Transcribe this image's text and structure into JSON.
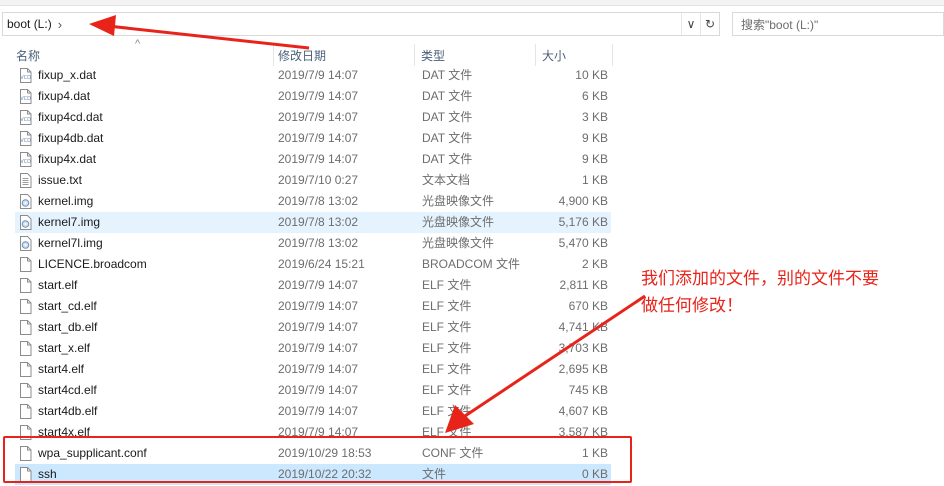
{
  "address": {
    "crumb": "boot (L:)",
    "chevron": "›",
    "dropdown_glyph": "∨",
    "refresh_glyph": "↻"
  },
  "search": {
    "placeholder": "搜索\"boot (L:)\""
  },
  "columns": {
    "name": "名称",
    "date": "修改日期",
    "type": "类型",
    "size": "大小"
  },
  "files": [
    {
      "icon": "dat-file-icon",
      "name": "fixup_x.dat",
      "date": "2019/7/9 14:07",
      "type": "DAT 文件",
      "size": "10 KB",
      "state": "normal"
    },
    {
      "icon": "dat-file-icon",
      "name": "fixup4.dat",
      "date": "2019/7/9 14:07",
      "type": "DAT 文件",
      "size": "6 KB",
      "state": "normal"
    },
    {
      "icon": "dat-file-icon",
      "name": "fixup4cd.dat",
      "date": "2019/7/9 14:07",
      "type": "DAT 文件",
      "size": "3 KB",
      "state": "normal"
    },
    {
      "icon": "dat-file-icon",
      "name": "fixup4db.dat",
      "date": "2019/7/9 14:07",
      "type": "DAT 文件",
      "size": "9 KB",
      "state": "normal"
    },
    {
      "icon": "dat-file-icon",
      "name": "fixup4x.dat",
      "date": "2019/7/9 14:07",
      "type": "DAT 文件",
      "size": "9 KB",
      "state": "normal"
    },
    {
      "icon": "text-file-icon",
      "name": "issue.txt",
      "date": "2019/7/10 0:27",
      "type": "文本文档",
      "size": "1 KB",
      "state": "normal"
    },
    {
      "icon": "disc-image-icon",
      "name": "kernel.img",
      "date": "2019/7/8 13:02",
      "type": "光盘映像文件",
      "size": "4,900 KB",
      "state": "normal"
    },
    {
      "icon": "disc-image-icon",
      "name": "kernel7.img",
      "date": "2019/7/8 13:02",
      "type": "光盘映像文件",
      "size": "5,176 KB",
      "state": "hover"
    },
    {
      "icon": "disc-image-icon",
      "name": "kernel7l.img",
      "date": "2019/7/8 13:02",
      "type": "光盘映像文件",
      "size": "5,470 KB",
      "state": "normal"
    },
    {
      "icon": "blank-file-icon",
      "name": "LICENCE.broadcom",
      "date": "2019/6/24 15:21",
      "type": "BROADCOM 文件",
      "size": "2 KB",
      "state": "normal"
    },
    {
      "icon": "blank-file-icon",
      "name": "start.elf",
      "date": "2019/7/9 14:07",
      "type": "ELF 文件",
      "size": "2,811 KB",
      "state": "normal"
    },
    {
      "icon": "blank-file-icon",
      "name": "start_cd.elf",
      "date": "2019/7/9 14:07",
      "type": "ELF 文件",
      "size": "670 KB",
      "state": "normal"
    },
    {
      "icon": "blank-file-icon",
      "name": "start_db.elf",
      "date": "2019/7/9 14:07",
      "type": "ELF 文件",
      "size": "4,741 KB",
      "state": "normal"
    },
    {
      "icon": "blank-file-icon",
      "name": "start_x.elf",
      "date": "2019/7/9 14:07",
      "type": "ELF 文件",
      "size": "3,703 KB",
      "state": "normal"
    },
    {
      "icon": "blank-file-icon",
      "name": "start4.elf",
      "date": "2019/7/9 14:07",
      "type": "ELF 文件",
      "size": "2,695 KB",
      "state": "normal"
    },
    {
      "icon": "blank-file-icon",
      "name": "start4cd.elf",
      "date": "2019/7/9 14:07",
      "type": "ELF 文件",
      "size": "745 KB",
      "state": "normal"
    },
    {
      "icon": "blank-file-icon",
      "name": "start4db.elf",
      "date": "2019/7/9 14:07",
      "type": "ELF 文件",
      "size": "4,607 KB",
      "state": "normal"
    },
    {
      "icon": "blank-file-icon",
      "name": "start4x.elf",
      "date": "2019/7/9 14:07",
      "type": "ELF 文件",
      "size": "3,587 KB",
      "state": "normal"
    },
    {
      "icon": "blank-file-icon",
      "name": "wpa_supplicant.conf",
      "date": "2019/10/29 18:53",
      "type": "CONF 文件",
      "size": "1 KB",
      "state": "normal"
    },
    {
      "icon": "blank-file-icon",
      "name": "ssh",
      "date": "2019/10/22 20:32",
      "type": "文件",
      "size": "0 KB",
      "state": "selected"
    }
  ],
  "annotation": {
    "line1": "我们添加的文件，别的文件不要",
    "line2": "做任何修改！",
    "color": "#e8231a"
  },
  "colors": {
    "hover_row": "#e5f3ff",
    "selected_row": "#cce8ff",
    "header_text": "#4c607a",
    "secondary_text": "#6d6d6d"
  }
}
